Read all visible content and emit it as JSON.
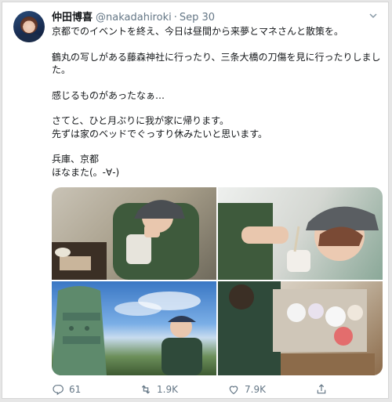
{
  "user": {
    "name": "仲田博喜",
    "handle": "@nakadahiroki",
    "separator": "·",
    "date": "Sep 30"
  },
  "tweet": {
    "paragraphs": [
      "京都でのイベントを終え、今日は昼間から来夢とマネさんと散策を。",
      "鶴丸の写しがある藤森神社に行ったり、三条大橋の刀傷を見に行ったりしました。",
      "感じるものがあったなぁ…",
      "さてと、ひと月ぶりに我が家に帰ります。\n先ずは家のベッドでぐっすり休みたいと思います。",
      "兵庫、京都\nほなまた(。-∀-)"
    ]
  },
  "photos": {
    "count": 4
  },
  "actions": {
    "reply_count": "61",
    "retweet_count": "1.9K",
    "like_count": "7.9K"
  },
  "icons": {
    "caret": "chevron-down-icon",
    "reply": "reply-icon",
    "retweet": "retweet-icon",
    "like": "heart-icon",
    "share": "share-icon"
  },
  "colors": {
    "text_primary": "#14171a",
    "text_secondary": "#657786",
    "border": "#d6d6d6"
  }
}
